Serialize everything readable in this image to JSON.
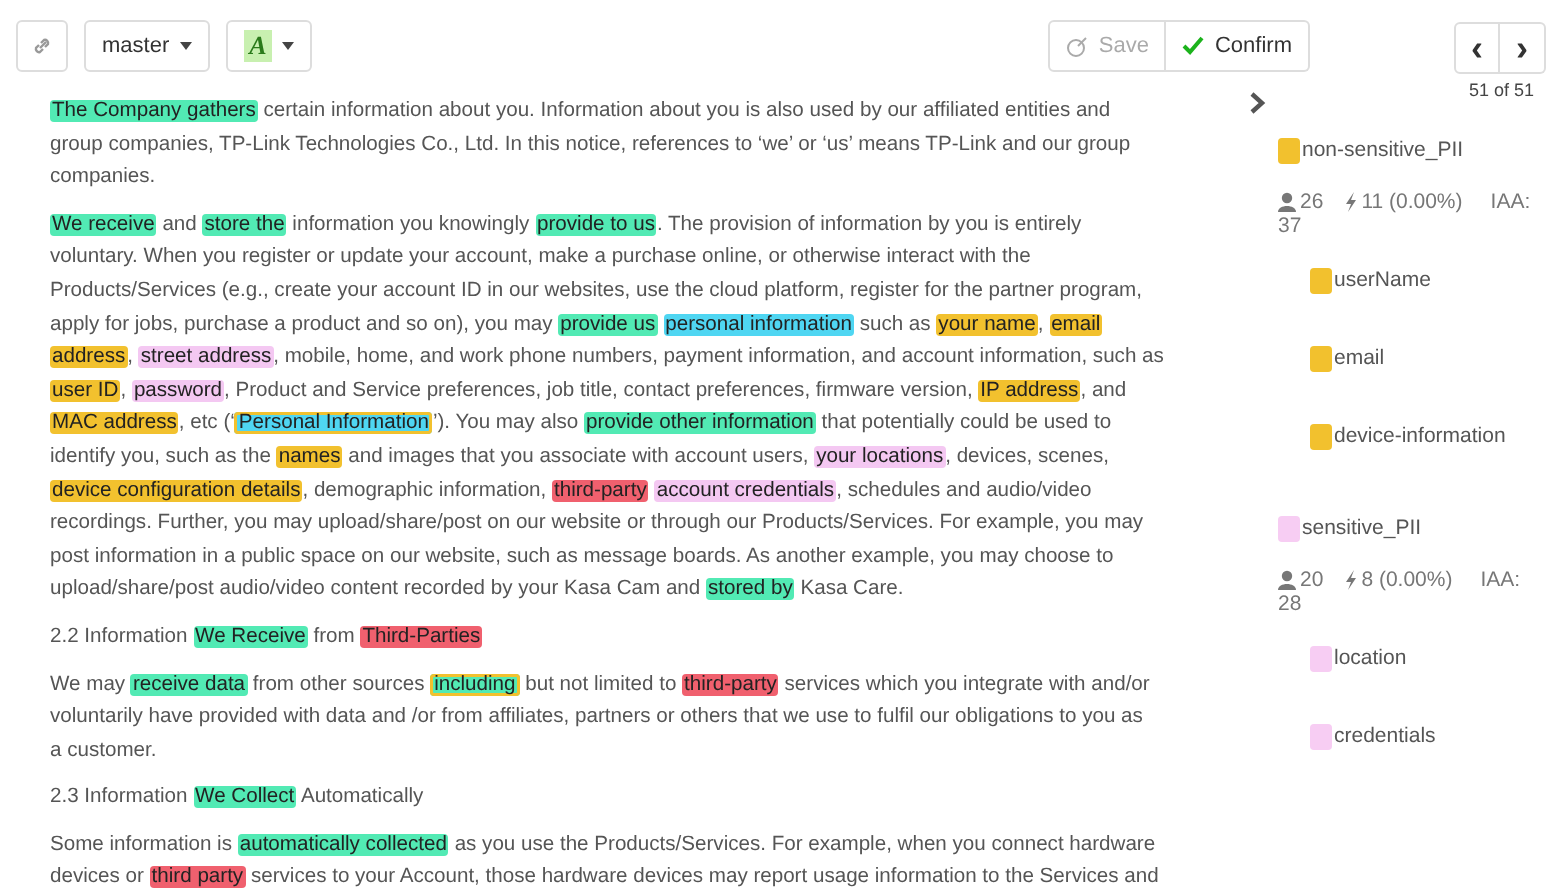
{
  "toolbar": {
    "branch": "master",
    "format_letter": "A",
    "save": {
      "label": "Save",
      "disabled": true
    },
    "confirm": {
      "label": "Confirm"
    },
    "prev": "‹",
    "next": "›",
    "counter": "51 of 51"
  },
  "document": [
    {
      "lines": [
        {
          "segments": [
            {
              "text": "The Company gathers",
              "color": "#52eab4"
            },
            {
              "text": " certain information about you. Information about you is also used by our affiliated entities and"
            }
          ]
        },
        {
          "segments": [
            {
              "text": "group companies, TP-Link Technologies Co., Ltd. In this notice, references to ‘we’ or ‘us’ means TP-Link and our group"
            }
          ]
        },
        {
          "segments": [
            {
              "text": "companies."
            }
          ]
        }
      ]
    },
    {
      "lines": [
        {
          "segments": [
            {
              "text": "We receive",
              "color": "#52eab4"
            },
            {
              "text": " and "
            },
            {
              "text": "store the",
              "color": "#52eab4"
            },
            {
              "text": " information you knowingly "
            },
            {
              "text": "provide to us",
              "color": "#52eab4"
            },
            {
              "text": ". The provision of information by you is entirely"
            }
          ]
        },
        {
          "segments": [
            {
              "text": "voluntary. When you register or update your account, make a purchase online, or otherwise interact with the"
            }
          ]
        },
        {
          "segments": [
            {
              "text": "Products/Services (e.g., create your account ID in our websites, use the cloud platform, register for the partner program,"
            }
          ]
        },
        {
          "segments": [
            {
              "text": "apply for jobs, purchase a product and so on), you may "
            },
            {
              "text": "provide us",
              "color": "#52eab4"
            },
            {
              "text": "personal information",
              "color": "#4fd6f2"
            },
            {
              "text": " such as "
            },
            {
              "text": "your name",
              "color": "#f2c12e"
            },
            {
              "text": ", "
            },
            {
              "text": "email",
              "color": "#f2c12e"
            }
          ]
        },
        {
          "segments": [
            {
              "text": "address",
              "color": "#f2c12e"
            },
            {
              "text": ", "
            },
            {
              "text": "street address",
              "color": "#f4c8f2"
            },
            {
              "text": ", mobile, home, and work phone numbers, payment information, and account information, such as"
            }
          ]
        },
        {
          "segments": [
            {
              "text": "user ID",
              "color": "#f2c12e"
            },
            {
              "text": ", "
            },
            {
              "text": "password",
              "color": "#f4c8f2"
            },
            {
              "text": ", Product and Service preferences, job title, contact preferences, firmware version, "
            },
            {
              "text": "IP address",
              "color": "#f2c12e"
            },
            {
              "text": ", and"
            }
          ]
        },
        {
          "segments": [
            {
              "text": "MAC address",
              "color": "#f2c12e"
            },
            {
              "text": ", etc (‘"
            },
            {
              "text": "Personal Information",
              "color": "#4fd6f2",
              "kind": "outlined"
            },
            {
              "text": "’). You may also "
            },
            {
              "text": "provide other information",
              "color": "#52eab4"
            },
            {
              "text": " that potentially could be used to"
            }
          ]
        },
        {
          "segments": [
            {
              "text": "identify you, such as the "
            },
            {
              "text": "names",
              "color": "#f2c12e"
            },
            {
              "text": " and images that you associate with account users, "
            },
            {
              "text": "your locations",
              "color": "#f4c8f2"
            },
            {
              "text": ", devices, scenes,"
            }
          ]
        },
        {
          "segments": [
            {
              "text": "device configuration details",
              "color": "#f2c12e"
            },
            {
              "text": ", demographic information, "
            },
            {
              "text": "third-party",
              "color": "#f0606e"
            },
            {
              "text": "account credentials",
              "color": "#f4c8f2"
            },
            {
              "text": ", schedules and audio/video"
            }
          ]
        },
        {
          "segments": [
            {
              "text": "recordings. Further, you may upload/share/post on our website or through our Products/Services. For example, you may"
            }
          ]
        },
        {
          "segments": [
            {
              "text": "post information in a public space on our website, such as message boards. As another example, you may choose to"
            }
          ]
        },
        {
          "segments": [
            {
              "text": "upload/share/post audio/video content recorded by your Kasa Cam and "
            },
            {
              "text": "stored by",
              "color": "#52eab4"
            },
            {
              "text": " Kasa Care."
            }
          ]
        }
      ]
    },
    {
      "lines": [
        {
          "segments": [
            {
              "text": "2.2 Information "
            },
            {
              "text": "We Receive",
              "color": "#52eab4"
            },
            {
              "text": " from "
            },
            {
              "text": "Third-Parties",
              "color": "#f0606e"
            }
          ]
        }
      ]
    },
    {
      "lines": [
        {
          "segments": [
            {
              "text": "We may "
            },
            {
              "text": "receive data",
              "color": "#52eab4"
            },
            {
              "text": " from other sources "
            },
            {
              "text": "including",
              "color": "#52eab4",
              "kind": "outlined"
            },
            {
              "text": " but not limited to "
            },
            {
              "text": "third-party",
              "color": "#f0606e"
            },
            {
              "text": " services which you integrate with and/or"
            }
          ]
        },
        {
          "segments": [
            {
              "text": "voluntarily have provided with data and /or from affiliates, partners or others that we use to fulfil our obligations to you as"
            }
          ]
        },
        {
          "segments": [
            {
              "text": "a customer."
            }
          ]
        }
      ]
    },
    {
      "lines": [
        {
          "segments": [
            {
              "text": "2.3 Information "
            },
            {
              "text": "We Collect",
              "color": "#52eab4"
            },
            {
              "text": " Automatically"
            }
          ]
        }
      ]
    },
    {
      "lines": [
        {
          "segments": [
            {
              "text": "Some information is "
            },
            {
              "text": "automatically collected",
              "color": "#52eab4"
            },
            {
              "text": " as you use the Products/Services. For example, when you connect hardware"
            }
          ]
        },
        {
          "segments": [
            {
              "text": "devices or "
            },
            {
              "text": "third party",
              "color": "#f0606e"
            },
            {
              "text": " services to your Account, those hardware devices may report usage information to the Services and"
            }
          ]
        }
      ]
    }
  ],
  "labels": [
    {
      "name": "non-sensitive_PII",
      "color": "#f2c12e",
      "annotators": "26",
      "count": "11 (0.00%)",
      "iaa": "IAA:",
      "iaa_value": "37",
      "children": [
        {
          "name": "userName",
          "color": "#f2c12e"
        },
        {
          "name": "email",
          "color": "#f2c12e"
        },
        {
          "name": "device-information",
          "color": "#f2c12e"
        }
      ]
    },
    {
      "name": "sensitive_PII",
      "color": "#f7cdf3",
      "annotators": "20",
      "count": "8 (0.00%)",
      "iaa": "IAA:",
      "iaa_value": "28",
      "children": [
        {
          "name": "location",
          "color": "#f7cdf3"
        },
        {
          "name": "credentials",
          "color": "#f7cdf3"
        }
      ]
    }
  ]
}
